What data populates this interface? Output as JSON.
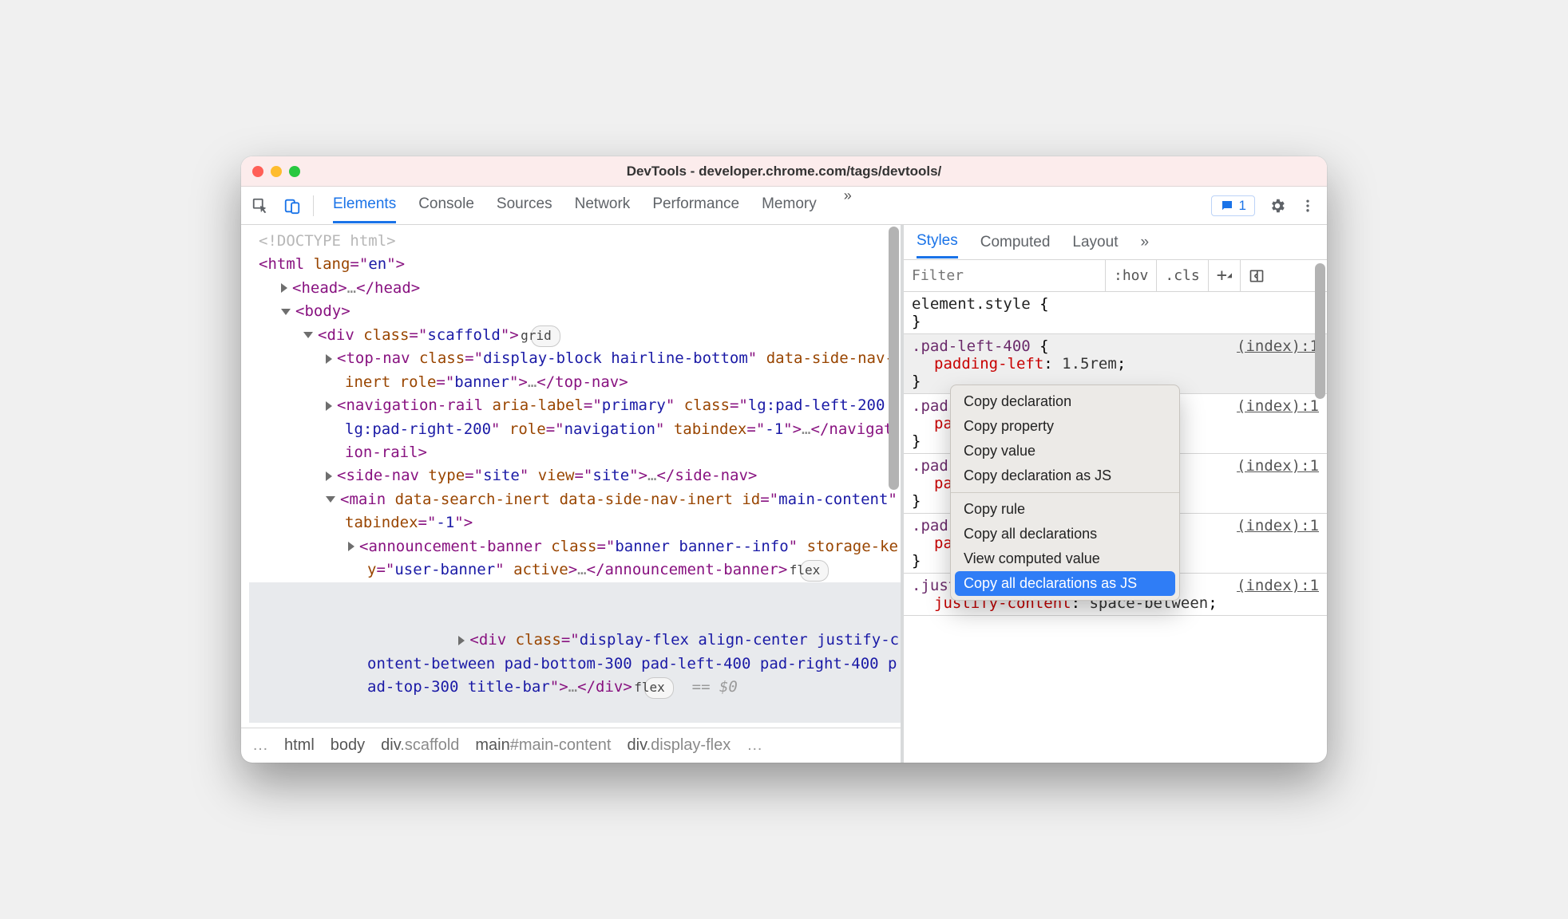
{
  "window": {
    "title": "DevTools - developer.chrome.com/tags/devtools/"
  },
  "toolbar": {
    "tabs": [
      "Elements",
      "Console",
      "Sources",
      "Network",
      "Performance",
      "Memory"
    ],
    "active": "Elements",
    "more": "»",
    "issues_count": "1"
  },
  "dom": {
    "doctype": "<!DOCTYPE html>",
    "html_open": {
      "tag": "html",
      "attrs": [
        [
          "lang",
          "en"
        ]
      ]
    },
    "head": {
      "tag": "head"
    },
    "body": {
      "tag": "body"
    },
    "scaffold": {
      "tag": "div",
      "attrs": [
        [
          "class",
          "scaffold"
        ]
      ],
      "badge": "grid"
    },
    "topnav": {
      "tag": "top-nav",
      "attrs": [
        [
          "class",
          "display-block hairline-bottom"
        ],
        [
          "data-side-nav-inert",
          ""
        ],
        [
          "role",
          "banner"
        ]
      ]
    },
    "navrail": {
      "tag": "navigation-rail",
      "attrs": [
        [
          "aria-label",
          "primary"
        ],
        [
          "class",
          "lg:pad-left-200 lg:pad-right-200"
        ],
        [
          "role",
          "navigation"
        ],
        [
          "tabindex",
          "-1"
        ]
      ]
    },
    "sidenav": {
      "tag": "side-nav",
      "attrs": [
        [
          "type",
          "site"
        ],
        [
          "view",
          "site"
        ]
      ]
    },
    "main": {
      "tag": "main",
      "attrs": [
        [
          "data-search-inert",
          ""
        ],
        [
          "data-side-nav-inert",
          ""
        ],
        [
          "id",
          "main-content"
        ],
        [
          "tabindex",
          "-1"
        ]
      ]
    },
    "ann": {
      "tag": "announcement-banner",
      "attrs": [
        [
          "class",
          "banner banner--info"
        ],
        [
          "storage-key",
          "user-banner"
        ],
        [
          "active",
          ""
        ]
      ],
      "badge": "flex"
    },
    "seldiv": {
      "tag": "div",
      "attrs": [
        [
          "class",
          "display-flex align-center justify-content-between pad-bottom-300 pad-left-400 pad-right-400 pad-top-300 title-bar"
        ]
      ],
      "badge": "flex",
      "tail": "== $0"
    }
  },
  "breadcrumbs": [
    "…",
    "html",
    "body",
    "div.scaffold",
    "main#main-content",
    "div.display-flex",
    "…"
  ],
  "styles": {
    "subtabs": [
      "Styles",
      "Computed",
      "Layout"
    ],
    "subtabs_more": "»",
    "active": "Styles",
    "filter_placeholder": "Filter",
    "toolbar_items": [
      ":hov",
      ".cls",
      "+"
    ],
    "rules": [
      {
        "selector": "element.style",
        "src": "",
        "decls": []
      },
      {
        "selector": ".pad-left-400",
        "src": "(index):1",
        "decls": [
          [
            "padding-left",
            "1.5rem"
          ]
        ],
        "hl": true
      },
      {
        "selector": ".pad-",
        "src": "(index):1",
        "decls": [
          [
            "pa",
            ""
          ]
        ]
      },
      {
        "selector": ".pad-",
        "src": "(index):1",
        "decls": [
          [
            "pa",
            ""
          ]
        ]
      },
      {
        "selector": ".pad-",
        "src": "(index):1",
        "decls": [
          [
            "pa",
            ""
          ]
        ]
      },
      {
        "selector": ".justify-content-between",
        "src": "(index):1",
        "decls": [
          [
            "justify-content",
            "space-between"
          ]
        ]
      }
    ]
  },
  "contextmenu": {
    "items": [
      "Copy declaration",
      "Copy property",
      "Copy value",
      "Copy declaration as JS",
      "---",
      "Copy rule",
      "Copy all declarations",
      "View computed value",
      "Copy all declarations as JS"
    ],
    "selected": "Copy all declarations as JS"
  }
}
